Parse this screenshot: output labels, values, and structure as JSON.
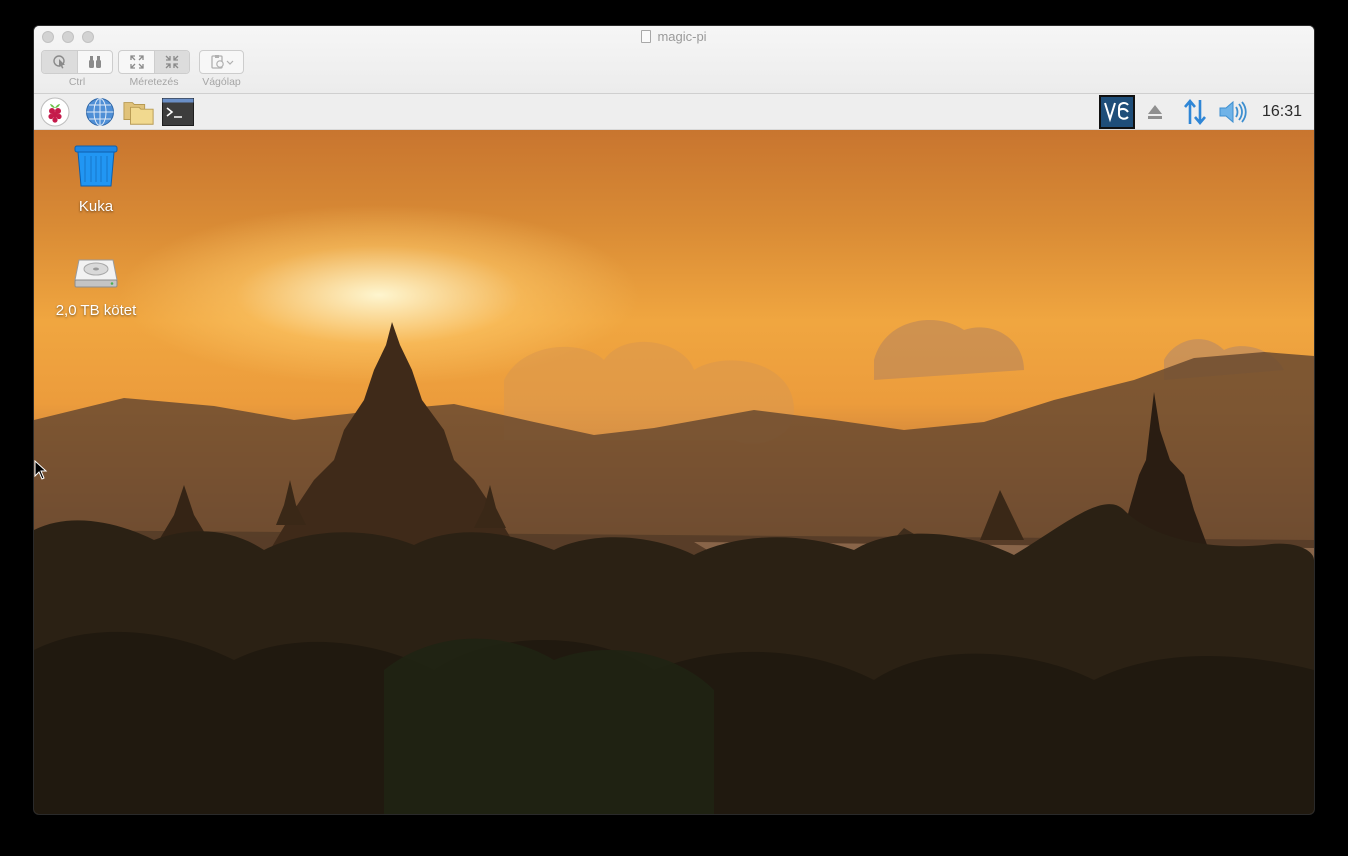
{
  "window": {
    "title": "magic-pi"
  },
  "toolbar": {
    "groups": [
      {
        "label": "Ctrl"
      },
      {
        "label": "Méretezés"
      },
      {
        "label": "Vágólap"
      }
    ]
  },
  "taskbar": {
    "launchers": [
      "raspberry-menu-icon",
      "web-browser-icon",
      "file-manager-icon",
      "terminal-icon"
    ],
    "tray": [
      "vnc-icon",
      "eject-icon",
      "network-icon",
      "volume-icon"
    ],
    "clock": "16:31"
  },
  "desktop": {
    "icons": [
      {
        "label": "Kuka"
      },
      {
        "label": "2,0 TB kötet"
      }
    ]
  },
  "colors": {
    "vnc_bg": "#1f4e79",
    "accent_blue": "#2f86d6"
  }
}
